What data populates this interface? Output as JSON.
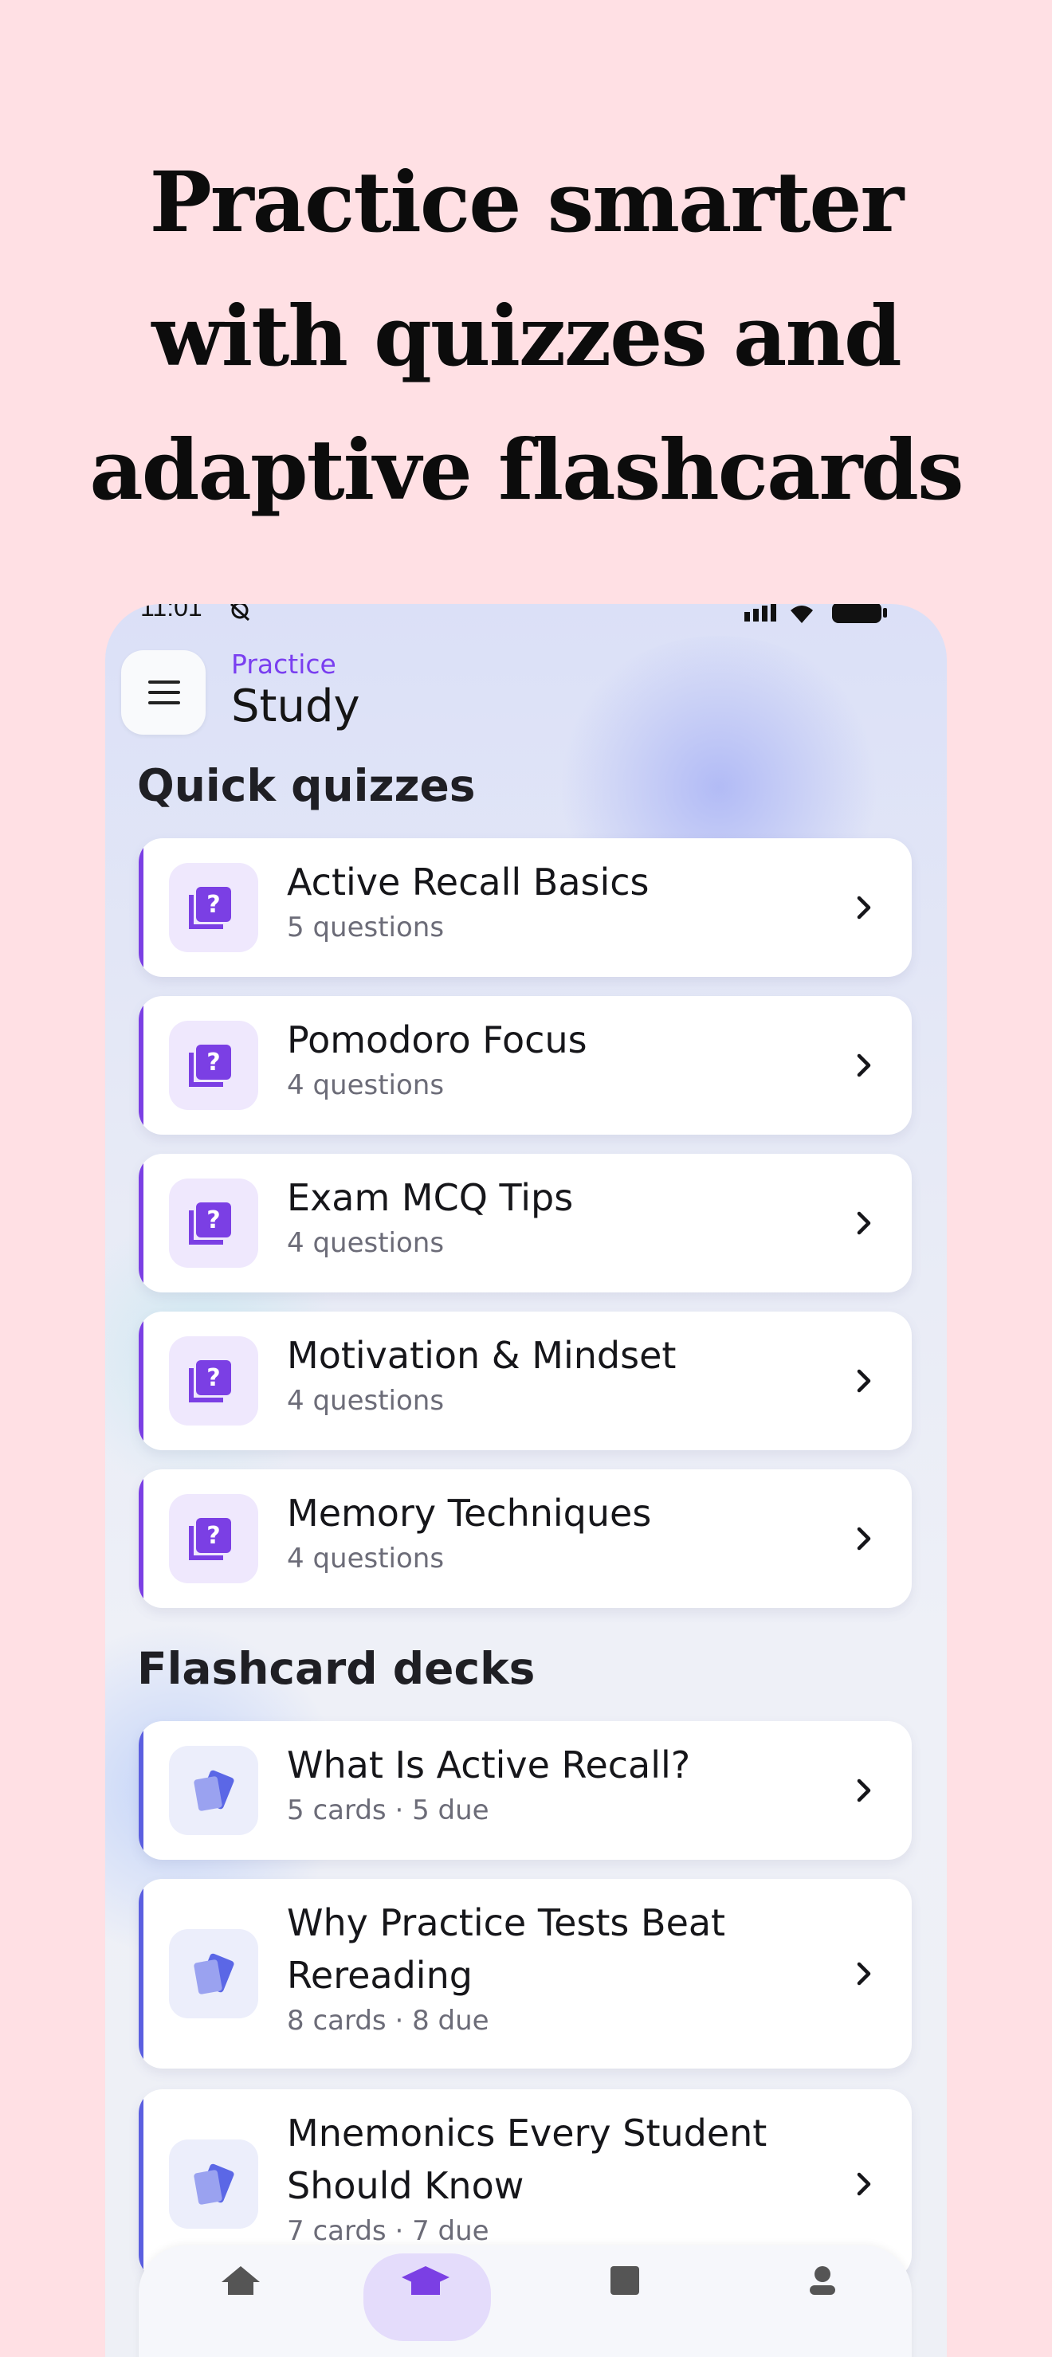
{
  "headline": {
    "lines": [
      "Practice smarter",
      "with quizzes and",
      "adaptive flashcards"
    ]
  },
  "status_bar": {
    "time": "11:01"
  },
  "header": {
    "overline": "Practice",
    "title": "Study",
    "menu_icon": "hamburger-menu-icon"
  },
  "quick_quizzes": {
    "heading": "Quick quizzes",
    "icon": "quiz-question-icon",
    "accent_color": "#7b3fe4",
    "items": [
      {
        "title": "Active Recall Basics",
        "subtitle": "5 questions"
      },
      {
        "title": "Pomodoro Focus",
        "subtitle": "4 questions"
      },
      {
        "title": "Exam MCQ Tips",
        "subtitle": "4 questions"
      },
      {
        "title": "Motivation & Mindset",
        "subtitle": "4 questions"
      },
      {
        "title": "Memory Techniques",
        "subtitle": "4 questions"
      }
    ]
  },
  "flashcard_decks": {
    "heading": "Flashcard decks",
    "icon": "flashcards-icon",
    "accent_color": "#5b5fe0",
    "items": [
      {
        "title_lines": [
          "What Is Active Recall?"
        ],
        "subtitle": "5 cards · 5 due"
      },
      {
        "title_lines": [
          "Why Practice Tests Beat",
          "Rereading"
        ],
        "subtitle": "8 cards · 8 due"
      },
      {
        "title_lines": [
          "Mnemonics Every Student",
          "Should Know"
        ],
        "subtitle": "7 cards · 7 due"
      }
    ]
  },
  "bottom_nav": {
    "items": [
      {
        "icon": "home-icon",
        "active": false
      },
      {
        "icon": "graduation-cap-icon",
        "active": true
      },
      {
        "icon": "book-icon",
        "active": false
      },
      {
        "icon": "profile-icon",
        "active": false
      }
    ]
  }
}
